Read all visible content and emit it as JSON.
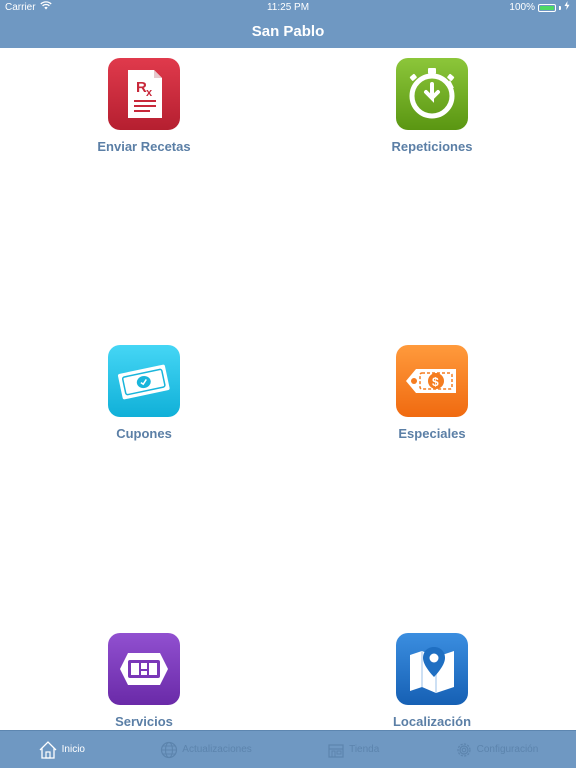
{
  "status": {
    "carrier": "Carrier",
    "time": "11:25 PM",
    "battery": "100%"
  },
  "nav": {
    "title": "San Pablo"
  },
  "tiles": [
    {
      "label": "Enviar Recetas",
      "icon": "prescription-icon",
      "color": "#c8283a"
    },
    {
      "label": "Repeticiones",
      "icon": "stopwatch-refill-icon",
      "color": "#6aa51a"
    },
    {
      "label": "Cupones",
      "icon": "cash-coupon-icon",
      "color": "#1cc2e6"
    },
    {
      "label": "Especiales",
      "icon": "price-tag-icon",
      "color": "#ff7a1e"
    },
    {
      "label": "Servicios",
      "icon": "services-icon",
      "color": "#7a37b8"
    },
    {
      "label": "Localización",
      "icon": "map-pin-icon",
      "color": "#1f6fc2"
    }
  ],
  "tabs": [
    {
      "label": "Inicio",
      "icon": "home-icon",
      "active": true
    },
    {
      "label": "Actualizaciones",
      "icon": "globe-icon",
      "active": false
    },
    {
      "label": "Tienda",
      "icon": "store-icon",
      "active": false
    },
    {
      "label": "Configuración",
      "icon": "gear-icon",
      "active": false
    }
  ]
}
